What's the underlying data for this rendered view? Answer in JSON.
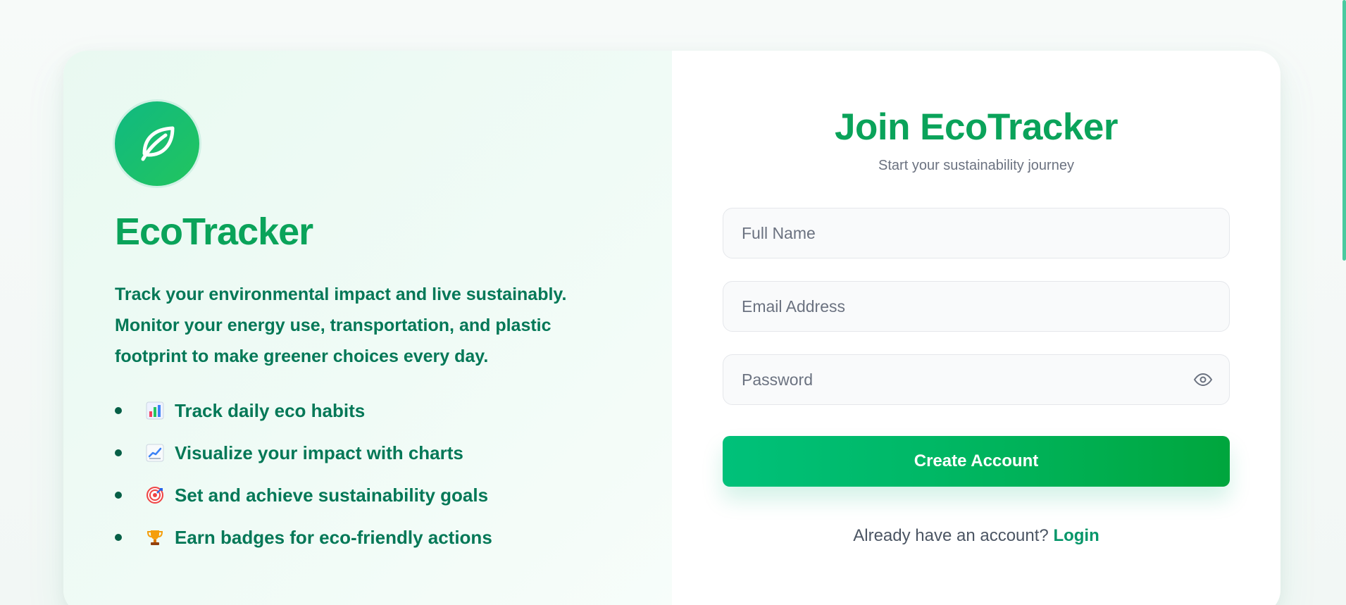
{
  "brand": {
    "name": "EcoTracker",
    "description": "Track your environmental impact and live sustainably. Monitor your energy use, transportation, and plastic footprint to make greener choices every day."
  },
  "features": [
    {
      "icon": "bar-chart-icon",
      "label": "Track daily eco habits"
    },
    {
      "icon": "line-chart-icon",
      "label": "Visualize your impact with charts"
    },
    {
      "icon": "target-icon",
      "label": "Set and achieve sustainability goals"
    },
    {
      "icon": "trophy-icon",
      "label": "Earn badges for eco-friendly actions"
    }
  ],
  "form": {
    "title": "Join EcoTracker",
    "subtitle": "Start your sustainability journey",
    "full_name": {
      "placeholder": "Full Name",
      "value": ""
    },
    "email": {
      "placeholder": "Email Address",
      "value": ""
    },
    "password": {
      "placeholder": "Password",
      "value": ""
    },
    "submit_label": "Create Account",
    "footer_text": "Already have an account?",
    "login_label": "Login"
  },
  "colors": {
    "primary": "#10b981",
    "primary_dark": "#047857",
    "brand_green": "#0aa35a",
    "text_muted": "#6b7280"
  },
  "icons": {
    "logo": "leaf-icon",
    "password_toggle": "eye-icon"
  }
}
